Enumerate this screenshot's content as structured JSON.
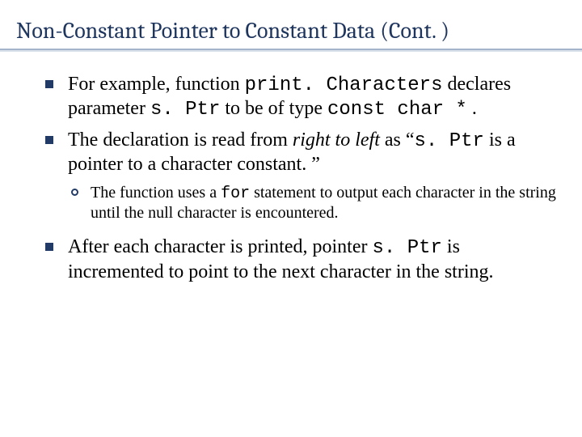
{
  "title": "Non-Constant Pointer to Constant Data (Cont. )",
  "bullets": {
    "b1": {
      "t1": "For example, function ",
      "c1": "print. Characters",
      "t2": " declares parameter ",
      "c2": "s. Ptr",
      "t3": " to be of type ",
      "c3": "const char *",
      "t4": " ."
    },
    "b2": {
      "t1": "The declaration is read from ",
      "i1": "right to left",
      "t2": " as “",
      "c1": "s. Ptr",
      "t3": " is a pointer to a character constant. ”"
    },
    "s1": {
      "t1": "The function uses a ",
      "c1": "for",
      "t2": " statement to output each character in the string until the null character is encountered."
    },
    "b3": {
      "t1": "After each character is printed, pointer ",
      "c1": "s. Ptr",
      "t2": " is incremented to point to the next character in the string."
    }
  }
}
